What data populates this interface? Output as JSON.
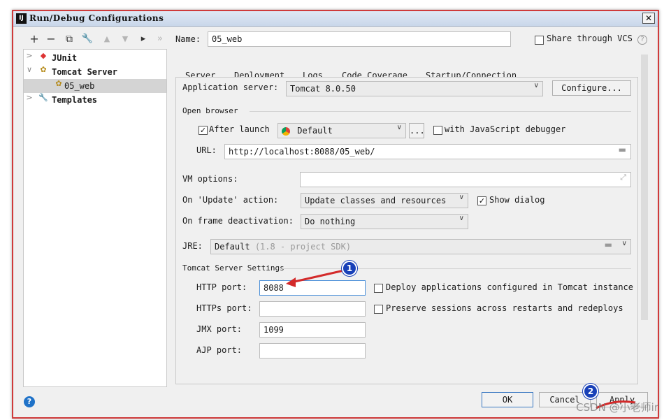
{
  "window": {
    "title": "Run/Debug Configurations",
    "close_glyph": "✕"
  },
  "toolbar": {
    "add": "+",
    "remove": "−",
    "copy": "⧉",
    "settings": "🔧",
    "up": "▲",
    "down": "▼",
    "folder": "▸",
    "more": "»"
  },
  "tree": {
    "items": [
      {
        "label": "JUnit",
        "chevron": ">",
        "icon": "junit-icon"
      },
      {
        "label": "Tomcat Server",
        "chevron": "∨",
        "icon": "tomcat-icon"
      },
      {
        "label": "05_web",
        "icon": "tomcat-icon"
      },
      {
        "label": "Templates",
        "chevron": ">",
        "icon": "wrench-icon"
      }
    ]
  },
  "name": {
    "label": "Name:",
    "value": "05_web"
  },
  "share": {
    "label": "Share through VCS",
    "checked": false,
    "help": "?"
  },
  "tabs": [
    "Server",
    "Deployment",
    "Logs",
    "Code Coverage",
    "Startup/Connection"
  ],
  "server": {
    "app_server_label": "Application server:",
    "app_server_value": "Tomcat 8.0.50",
    "configure_label": "Configure...",
    "open_browser_label": "Open browser",
    "after_launch_label": "After launch",
    "after_launch_checked": true,
    "browser_value": "Default",
    "browser_more": "...",
    "js_debugger_label": "with JavaScript debugger",
    "js_debugger_checked": false,
    "url_label": "URL:",
    "url_value": "http://localhost:8088/05_web/",
    "vm_options_label": "VM options:",
    "vm_options_value": "",
    "on_update_label": "On 'Update' action:",
    "on_update_value": "Update classes and resources",
    "show_dialog_label": "Show dialog",
    "show_dialog_checked": true,
    "frame_deact_label": "On frame deactivation:",
    "frame_deact_value": "Do nothing",
    "jre_label": "JRE:",
    "jre_value": "Default",
    "jre_hint": "(1.8 - project SDK)",
    "tomcat_settings_label": "Tomcat Server Settings",
    "http_port_label": "HTTP port:",
    "http_port_value": "8088",
    "https_port_label": "HTTPs port:",
    "https_port_value": "",
    "jmx_port_label": "JMX port:",
    "jmx_port_value": "1099",
    "ajp_port_label": "AJP port:",
    "ajp_port_value": "",
    "deploy_apps_label": "Deploy applications configured in Tomcat instance",
    "deploy_apps_checked": false,
    "preserve_sessions_label": "Preserve sessions across restarts and redeploys",
    "preserve_sessions_checked": false
  },
  "footer": {
    "ok": "OK",
    "cancel": "Cancel",
    "apply": "Apply",
    "help": "?"
  },
  "annotations": {
    "badge1": "1",
    "badge2": "2",
    "accent": "#d32a2a",
    "badge_color": "#1840b8"
  },
  "watermark": "CSDN @小老师ir"
}
